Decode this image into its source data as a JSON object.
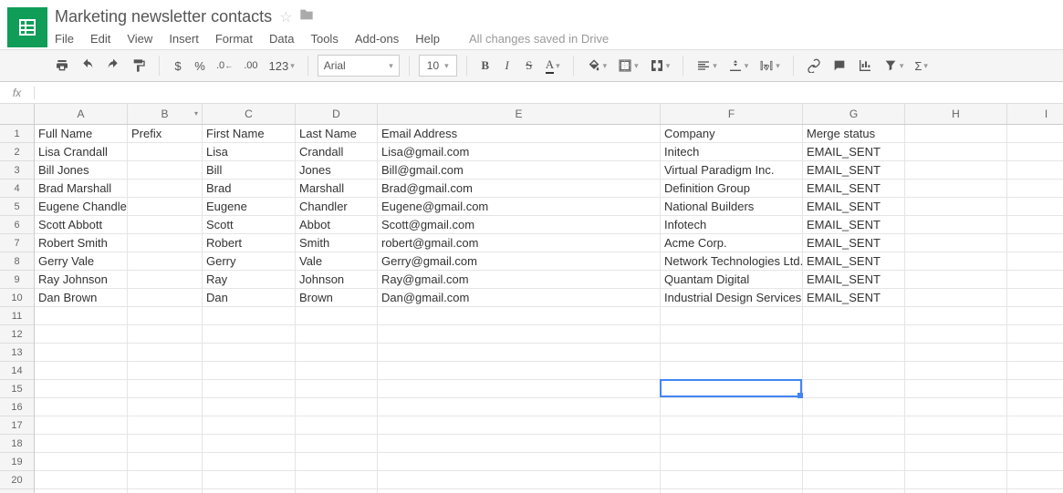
{
  "doc": {
    "title": "Marketing newsletter contacts"
  },
  "menu": {
    "file": "File",
    "edit": "Edit",
    "view": "View",
    "insert": "Insert",
    "format": "Format",
    "data": "Data",
    "tools": "Tools",
    "addons": "Add-ons",
    "help": "Help",
    "status": "All changes saved in Drive"
  },
  "toolbar": {
    "currency": "$",
    "percent": "%",
    "dec_dec": ".0←",
    "dec_inc": ".00",
    "num123": "123",
    "font": "Arial",
    "size": "10",
    "bold": "B",
    "italic": "I",
    "strike": "S",
    "textcolor": "A",
    "sigma": "Σ"
  },
  "fx": {
    "label": "fx"
  },
  "columns": [
    "A",
    "B",
    "C",
    "D",
    "E",
    "F",
    "G",
    "H",
    "I"
  ],
  "headers": {
    "A": "Full Name",
    "B": "Prefix",
    "C": "First Name",
    "D": "Last Name",
    "E": "Email Address",
    "F": "Company",
    "G": "Merge status"
  },
  "rows": [
    {
      "A": "Lisa Crandall",
      "C": "Lisa",
      "D": "Crandall",
      "E": "Lisa@gmail.com",
      "F": "Initech",
      "G": "EMAIL_SENT"
    },
    {
      "A": "Bill Jones",
      "C": "Bill",
      "D": "Jones",
      "E": "Bill@gmail.com",
      "F": "Virtual Paradigm Inc.",
      "G": "EMAIL_SENT"
    },
    {
      "A": "Brad Marshall",
      "C": "Brad",
      "D": "Marshall",
      "E": "Brad@gmail.com",
      "F": "Definition Group",
      "G": "EMAIL_SENT"
    },
    {
      "A": "Eugene Chandler",
      "C": "Eugene",
      "D": "Chandler",
      "E": "Eugene@gmail.com",
      "F": "National Builders",
      "G": "EMAIL_SENT"
    },
    {
      "A": "Scott Abbott",
      "C": "Scott",
      "D": "Abbot",
      "E": "Scott@gmail.com",
      "F": "Infotech",
      "G": "EMAIL_SENT"
    },
    {
      "A": "Robert Smith",
      "C": "Robert",
      "D": "Smith",
      "E": "robert@gmail.com",
      "F": "Acme Corp.",
      "G": "EMAIL_SENT"
    },
    {
      "A": "Gerry Vale",
      "C": "Gerry",
      "D": "Vale",
      "E": "Gerry@gmail.com",
      "F": "Network Technologies Ltd.",
      "G": "EMAIL_SENT"
    },
    {
      "A": "Ray Johnson",
      "C": "Ray",
      "D": "Johnson",
      "E": "Ray@gmail.com",
      "F": "Quantam Digital",
      "G": "EMAIL_SENT"
    },
    {
      "A": "Dan Brown",
      "C": "Dan",
      "D": "Brown",
      "E": "Dan@gmail.com",
      "F": "Industrial Design Services",
      "G": "EMAIL_SENT"
    }
  ],
  "active_cell": {
    "col": "F",
    "row": 15
  }
}
